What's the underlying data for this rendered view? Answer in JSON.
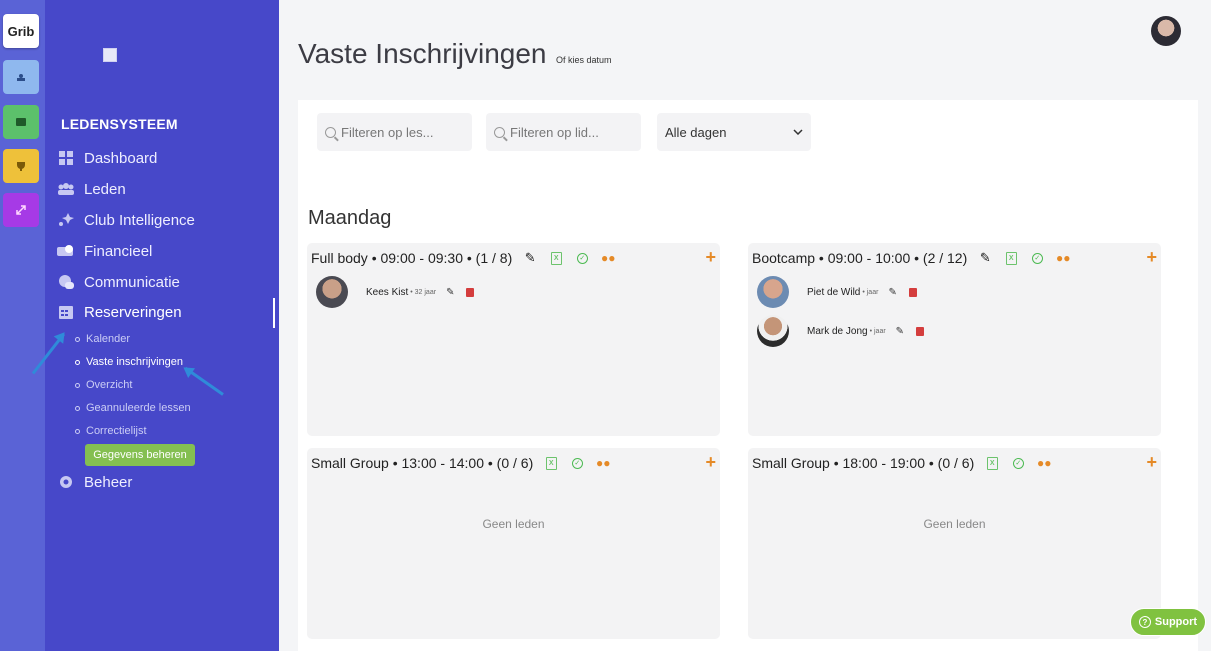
{
  "rail": {
    "logo": "Grib"
  },
  "sidebar": {
    "section": "LEDENSYSTEEM",
    "items": [
      {
        "label": "Dashboard"
      },
      {
        "label": "Leden"
      },
      {
        "label": "Club Intelligence"
      },
      {
        "label": "Financieel"
      },
      {
        "label": "Communicatie"
      },
      {
        "label": "Reserveringen"
      },
      {
        "label": "Beheer"
      }
    ],
    "subitems": [
      {
        "label": "Kalender"
      },
      {
        "label": "Vaste inschrijvingen"
      },
      {
        "label": "Overzicht"
      },
      {
        "label": "Geannuleerde lessen"
      },
      {
        "label": "Correctielijst"
      }
    ],
    "manage_button": "Gegevens beheren"
  },
  "header": {
    "title": "Vaste Inschrijvingen",
    "subtitle": "Of kies datum"
  },
  "filters": {
    "lesson_placeholder": "Filteren op les...",
    "member_placeholder": "Filteren op lid...",
    "day_select": "Alle dagen"
  },
  "day": "Maandag",
  "cards": [
    {
      "title": "Full body • 09:00 - 09:30 • (1 / 8)",
      "members": [
        {
          "name": "Kees Kist",
          "age": "• 32 jaar"
        }
      ]
    },
    {
      "title": "Bootcamp • 09:00 - 10:00 • (2 / 12)",
      "members": [
        {
          "name": "Piet de Wild",
          "age": "• jaar"
        },
        {
          "name": "Mark de Jong",
          "age": "• jaar"
        }
      ]
    },
    {
      "title": "Small Group • 13:00 - 14:00 • (0 / 6)",
      "empty": "Geen leden"
    },
    {
      "title": "Small Group • 18:00 - 19:00 • (0 / 6)",
      "empty": "Geen leden"
    }
  ],
  "support": "Support"
}
